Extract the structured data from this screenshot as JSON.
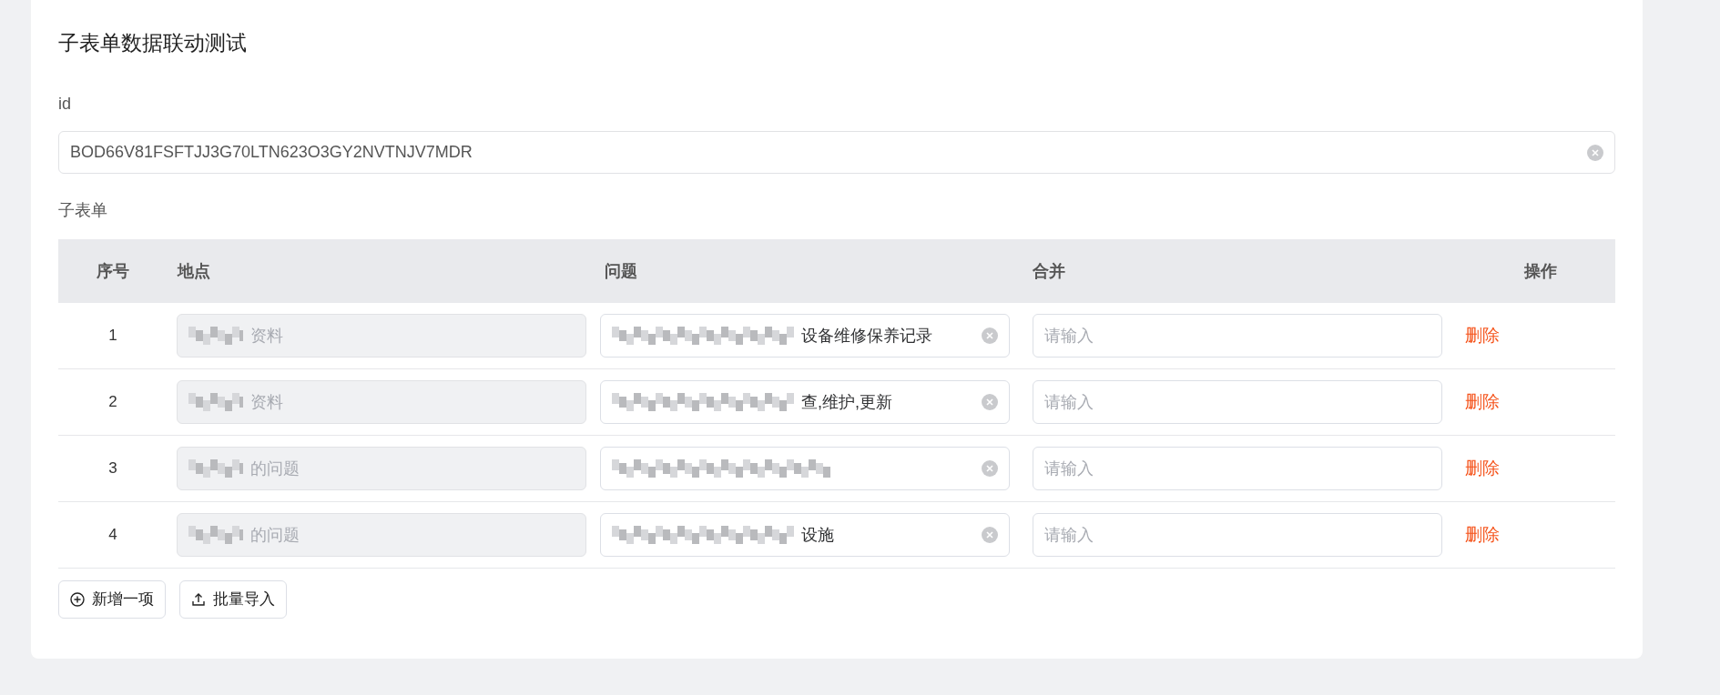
{
  "title": "子表单数据联动测试",
  "id_field": {
    "label": "id",
    "value": "BOD66V81FSFTJJ3G70LTN623O3GY2NVTNJV7MDR",
    "clearable": true
  },
  "subform": {
    "label": "子表单",
    "columns": [
      "序号",
      "地点",
      "问题",
      "合并",
      "操作"
    ],
    "rows": [
      {
        "index": "1",
        "place": {
          "value": "资料",
          "disabled": true,
          "redacted": true
        },
        "problem": {
          "value": "设备维修保养记录",
          "redacted": true,
          "clearable": true
        },
        "merge": {
          "placeholder": "请输入"
        },
        "action": "删除"
      },
      {
        "index": "2",
        "place": {
          "value": "资料",
          "disabled": true,
          "redacted": true
        },
        "problem": {
          "value": "查,维护,更新",
          "redacted": true,
          "clearable": true
        },
        "merge": {
          "placeholder": "请输入"
        },
        "action": "删除"
      },
      {
        "index": "3",
        "place": {
          "value": "的问题",
          "disabled": true,
          "redacted": true
        },
        "problem": {
          "redacted": true,
          "clearable": true
        },
        "merge": {
          "placeholder": "请输入"
        },
        "action": "删除"
      },
      {
        "index": "4",
        "place": {
          "value": "的问题",
          "disabled": true,
          "redacted": true
        },
        "problem": {
          "value": "设施",
          "redacted": true,
          "clearable": true
        },
        "merge": {
          "placeholder": "请输入"
        },
        "action": "删除"
      }
    ],
    "buttons": [
      {
        "kind": "add",
        "label": "新增一项"
      },
      {
        "kind": "import",
        "label": "批量导入"
      }
    ]
  }
}
